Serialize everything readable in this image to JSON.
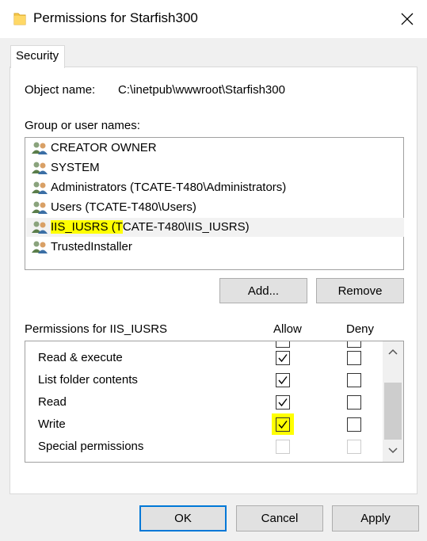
{
  "window": {
    "title": "Permissions for Starfish300",
    "folder_icon": "folder-icon",
    "close_icon": "close-icon"
  },
  "tabs": [
    {
      "label": "Security",
      "selected": true
    }
  ],
  "object": {
    "label": "Object name:",
    "value": "C:\\inetpub\\wwwroot\\Starfish300"
  },
  "users": {
    "label": "Group or user names:",
    "icon": "users-icon",
    "items": [
      {
        "name": "CREATOR OWNER"
      },
      {
        "name": "SYSTEM"
      },
      {
        "name": "Administrators (TCATE-T480\\Administrators)"
      },
      {
        "name": "Users (TCATE-T480\\Users)"
      },
      {
        "name_highlight": "IIS_IUSRS (T",
        "name_rest": "CATE-T480\\IIS_IUSRS)",
        "selected": true
      },
      {
        "name": "TrustedInstaller"
      }
    ]
  },
  "user_buttons": {
    "add": "Add...",
    "remove": "Remove"
  },
  "permissions": {
    "label": "Permissions for IIS_IUSRS",
    "allow_header": "Allow",
    "deny_header": "Deny",
    "rows": [
      {
        "label": "Read & execute",
        "allow": true,
        "deny": false
      },
      {
        "label": "List folder contents",
        "allow": true,
        "deny": false
      },
      {
        "label": "Read",
        "allow": true,
        "deny": false
      },
      {
        "label": "Write",
        "allow": true,
        "deny": false,
        "highlighted": true
      },
      {
        "label": "Special permissions",
        "allow": false,
        "deny": false,
        "disabled": true
      }
    ]
  },
  "dialog_buttons": {
    "ok": "OK",
    "cancel": "Cancel",
    "apply": "Apply"
  },
  "colors": {
    "highlight": "#ffff00",
    "focus_border": "#0078d7"
  }
}
